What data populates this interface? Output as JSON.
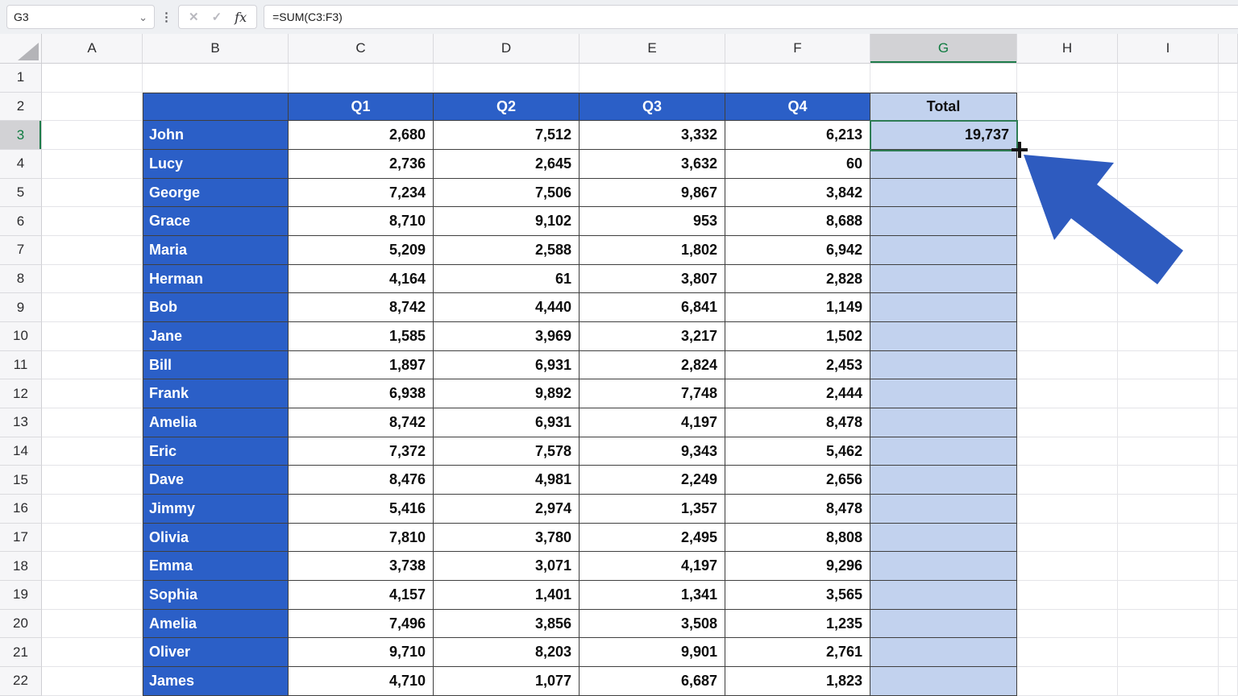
{
  "formula_bar": {
    "name_box": "G3",
    "formula": "=SUM(C3:F3)",
    "cancel_icon": "✕",
    "enter_icon": "✓",
    "function_icon": "fx",
    "chevron_icon": "⌄",
    "more_icon": "⋮"
  },
  "sheet": {
    "columns": [
      "A",
      "B",
      "C",
      "D",
      "E",
      "F",
      "G",
      "H",
      "I"
    ],
    "row_numbers": [
      1,
      2,
      3,
      4,
      5,
      6,
      7,
      8,
      9,
      10,
      11,
      12,
      13,
      14,
      15,
      16,
      17,
      18,
      19,
      20,
      21,
      22
    ],
    "highlighted_column": "G",
    "highlighted_row": 3,
    "active_cell": "G3"
  },
  "table": {
    "header_row": 2,
    "first_data_row": 3,
    "quarter_headers": [
      "Q1",
      "Q2",
      "Q3",
      "Q4"
    ],
    "total_header": "Total",
    "people": [
      {
        "name": "John",
        "values": [
          "2,680",
          "7,512",
          "3,332",
          "6,213"
        ],
        "total": "19,737"
      },
      {
        "name": "Lucy",
        "values": [
          "2,736",
          "2,645",
          "3,632",
          "60"
        ],
        "total": ""
      },
      {
        "name": "George",
        "values": [
          "7,234",
          "7,506",
          "9,867",
          "3,842"
        ],
        "total": ""
      },
      {
        "name": "Grace",
        "values": [
          "8,710",
          "9,102",
          "953",
          "8,688"
        ],
        "total": ""
      },
      {
        "name": "Maria",
        "values": [
          "5,209",
          "2,588",
          "1,802",
          "6,942"
        ],
        "total": ""
      },
      {
        "name": "Herman",
        "values": [
          "4,164",
          "61",
          "3,807",
          "2,828"
        ],
        "total": ""
      },
      {
        "name": "Bob",
        "values": [
          "8,742",
          "4,440",
          "6,841",
          "1,149"
        ],
        "total": ""
      },
      {
        "name": "Jane",
        "values": [
          "1,585",
          "3,969",
          "3,217",
          "1,502"
        ],
        "total": ""
      },
      {
        "name": "Bill",
        "values": [
          "1,897",
          "6,931",
          "2,824",
          "2,453"
        ],
        "total": ""
      },
      {
        "name": "Frank",
        "values": [
          "6,938",
          "9,892",
          "7,748",
          "2,444"
        ],
        "total": ""
      },
      {
        "name": "Amelia",
        "values": [
          "8,742",
          "6,931",
          "4,197",
          "8,478"
        ],
        "total": ""
      },
      {
        "name": "Eric",
        "values": [
          "7,372",
          "7,578",
          "9,343",
          "5,462"
        ],
        "total": ""
      },
      {
        "name": "Dave",
        "values": [
          "8,476",
          "4,981",
          "2,249",
          "2,656"
        ],
        "total": ""
      },
      {
        "name": "Jimmy",
        "values": [
          "5,416",
          "2,974",
          "1,357",
          "8,478"
        ],
        "total": ""
      },
      {
        "name": "Olivia",
        "values": [
          "7,810",
          "3,780",
          "2,495",
          "8,808"
        ],
        "total": ""
      },
      {
        "name": "Emma",
        "values": [
          "3,738",
          "3,071",
          "4,197",
          "9,296"
        ],
        "total": ""
      },
      {
        "name": "Sophia",
        "values": [
          "4,157",
          "1,401",
          "1,341",
          "3,565"
        ],
        "total": ""
      },
      {
        "name": "Amelia",
        "values": [
          "7,496",
          "3,856",
          "3,508",
          "1,235"
        ],
        "total": ""
      },
      {
        "name": "Oliver",
        "values": [
          "9,710",
          "8,203",
          "9,901",
          "2,761"
        ],
        "total": ""
      },
      {
        "name": "James",
        "values": [
          "4,710",
          "1,077",
          "6,687",
          "1,823"
        ],
        "total": ""
      }
    ]
  },
  "colors": {
    "table_header_blue": "#2b5fc7",
    "total_column_light_blue": "#c2d2ee",
    "active_cell_green_border": "#2e7d54",
    "header_highlight_gray": "#d2d2d5",
    "header_accent_green": "#107c41",
    "annotation_arrow_blue": "#2e5bbf"
  },
  "annotations": {
    "cursor": "fill-handle-plus-cursor",
    "arrow_target": "fill handle of cell G3"
  }
}
